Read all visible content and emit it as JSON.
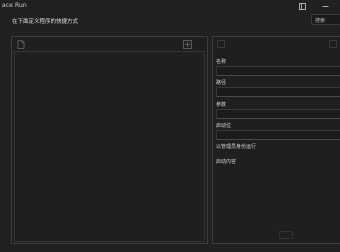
{
  "window": {
    "title": "ace Run"
  },
  "header": {
    "instruction": "在下面定义程序的快捷方式",
    "search_label": "搜索"
  },
  "form": {
    "fields": [
      {
        "label": "名称",
        "value": ""
      },
      {
        "label": "路径",
        "value": ""
      },
      {
        "label": "参数",
        "value": ""
      },
      {
        "label": "启动位",
        "value": ""
      }
    ],
    "checkbox_label": "以管理员身份运行",
    "extra_label": "启动内容"
  },
  "icons": {
    "layout": "layout-icon",
    "minimize": "minimize-icon",
    "file": "file-icon",
    "add": "add-icon"
  },
  "colors": {
    "background": "#202020",
    "panel_border": "#3d3d3d",
    "text": "#e6e6e6"
  }
}
